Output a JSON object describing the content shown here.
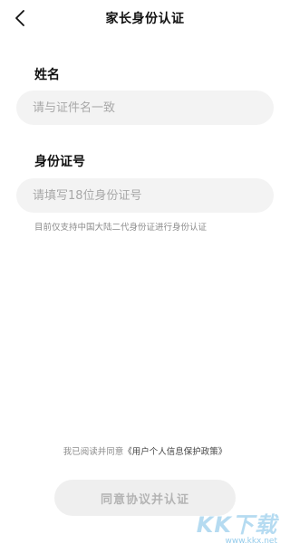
{
  "header": {
    "title": "家长身份认证",
    "back_icon": "chevron-left-icon"
  },
  "form": {
    "name_label": "姓名",
    "name_placeholder": "请与证件名一致",
    "name_value": "",
    "id_label": "身份证号",
    "id_placeholder": "请填写18位身份证号",
    "id_value": "",
    "hint": "目前仅支持中国大陆二代身份证进行身份认证"
  },
  "agreement": {
    "prefix": "我已阅读并同意",
    "link": "《用户个人信息保护政策》"
  },
  "submit_label": "同意协议并认证",
  "watermark": {
    "logo": "KK下载",
    "url": "www.kkx.net"
  },
  "colors": {
    "field_bg": "#f3f3f3",
    "button_bg": "#efefef",
    "button_text": "#b4b4b4",
    "hint_text": "#8c8c8c"
  }
}
